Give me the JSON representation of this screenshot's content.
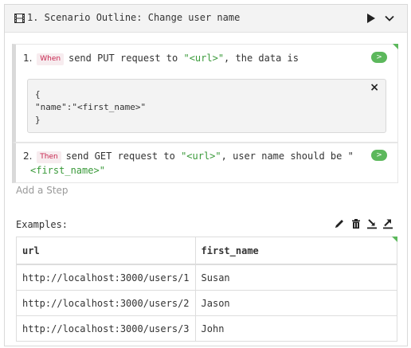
{
  "header": {
    "title": "1. Scenario Outline: Change user name",
    "icons": [
      "film-icon",
      "play-icon",
      "chevron-down-icon"
    ]
  },
  "steps": [
    {
      "number": "1.",
      "keyword": "When",
      "text_before": "send PUT request to ",
      "param": "\"<url>\"",
      "text_after": ", the data is",
      "run_label": ">",
      "docstring": {
        "lines": [
          "{",
          "\"name\":\"<first_name>\"",
          "}"
        ],
        "close_label": "×"
      }
    },
    {
      "number": "2.",
      "keyword": "Then",
      "text_before": "send GET request to ",
      "param": "\"<url>\"",
      "text_after": ", user name should be \"",
      "line2_param": "<first_name>\"",
      "run_label": ">"
    }
  ],
  "add_step_placeholder": "Add a Step",
  "examples": {
    "label": "Examples:",
    "icons": [
      "edit-icon",
      "trash-icon",
      "import-icon",
      "export-icon"
    ],
    "columns": [
      "url",
      "first_name"
    ],
    "rows": [
      [
        "http://localhost:3000/users/1",
        "Susan"
      ],
      [
        "http://localhost:3000/users/2",
        "Jason"
      ],
      [
        "http://localhost:3000/users/3",
        "John"
      ]
    ]
  },
  "colors": {
    "keyword_bg": "#f7ecef",
    "keyword_text": "#c7254e",
    "param_green": "#3a9a3a",
    "run_button": "#5cb85c",
    "header_bg": "#f3f3f3"
  }
}
